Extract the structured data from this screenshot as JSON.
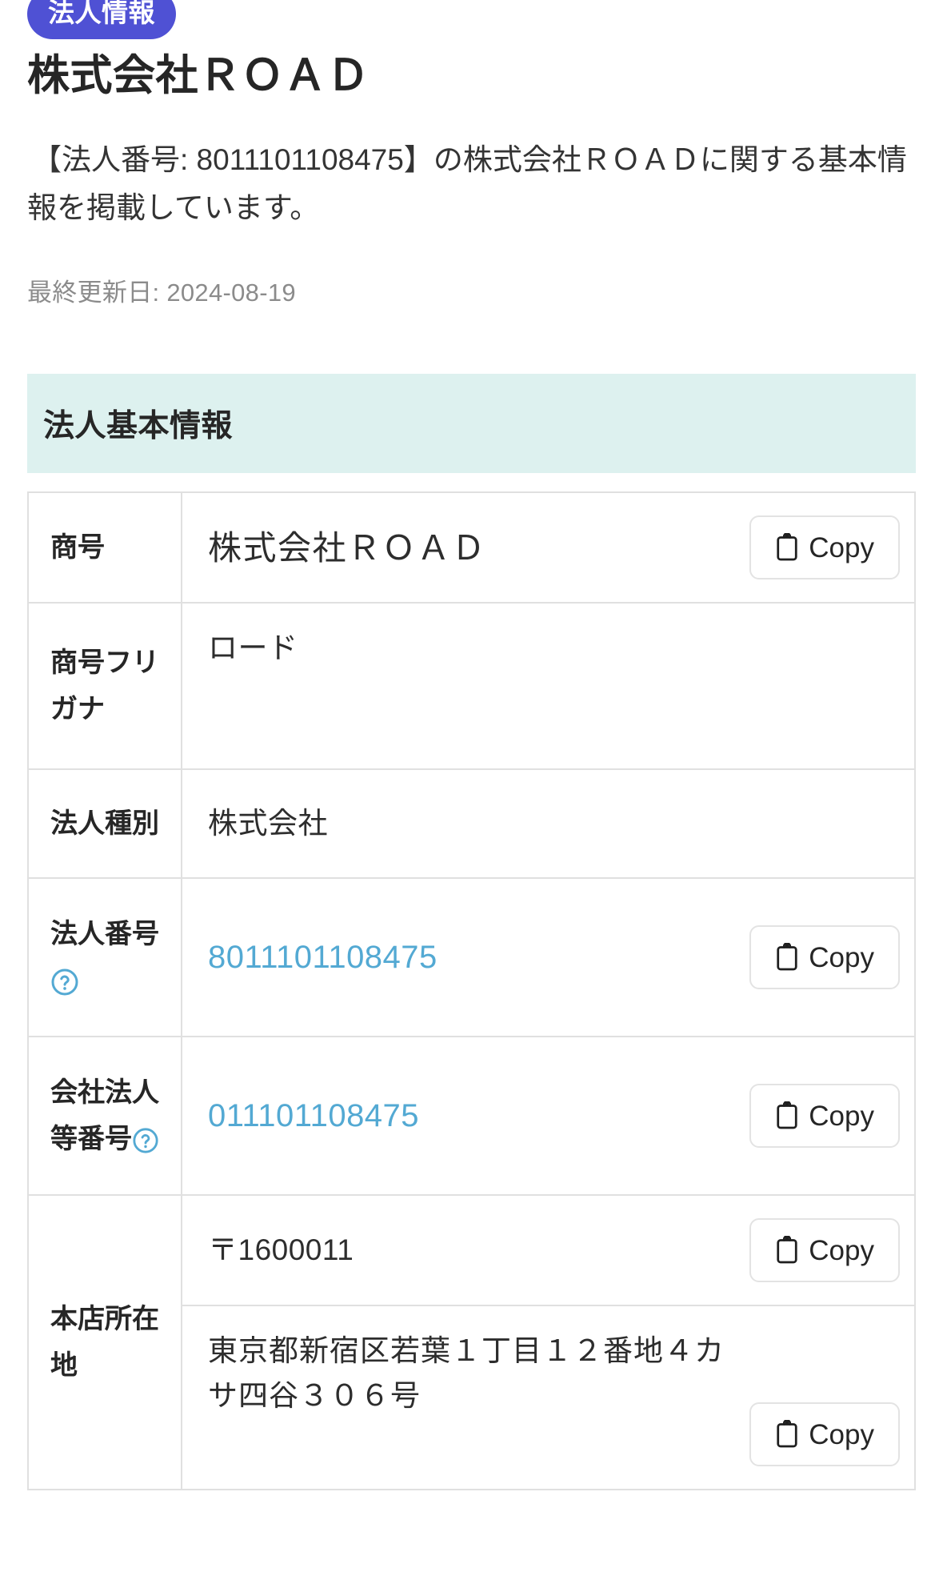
{
  "badge": {
    "label": "法人情報"
  },
  "header": {
    "title": "株式会社ＲＯＡＤ",
    "description": "【法人番号: 8011101108475】の株式会社ＲＯＡＤに関する基本情報を掲載しています。",
    "updated_label": "最終更新日: 2024-08-19"
  },
  "section": {
    "title": "法人基本情報"
  },
  "icons": {
    "copy": "clipboard-icon",
    "help": "question-circle-icon"
  },
  "colors": {
    "badge_bg": "#4f51d4",
    "section_bg": "#ddf1ef",
    "link": "#53a9d3",
    "border": "#e0e0e0",
    "muted_text": "#8b8b8b"
  },
  "buttons": {
    "copy_label": "Copy"
  },
  "table": {
    "rows": [
      {
        "label": "商号",
        "label_lines": [
          "商号"
        ],
        "has_help": false,
        "value": "株式会社ＲＯＡＤ",
        "is_link": false,
        "has_copy": true
      },
      {
        "label": "商号フリガナ",
        "label_lines": [
          "商号フリ",
          "ガナ"
        ],
        "has_help": false,
        "value": "ロード",
        "is_link": false,
        "has_copy": false
      },
      {
        "label": "法人種別",
        "label_lines": [
          "法人種別"
        ],
        "has_help": false,
        "value": "株式会社",
        "is_link": false,
        "has_copy": false
      },
      {
        "label": "法人番号",
        "label_lines": [
          "法人番号"
        ],
        "has_help": true,
        "value": "8011101108475",
        "is_link": true,
        "has_copy": true
      },
      {
        "label": "会社法人等番号",
        "label_lines": [
          "会社法人",
          "等番号"
        ],
        "has_help": true,
        "value": "011101108475",
        "is_link": true,
        "has_copy": true
      },
      {
        "label": "本店所在地",
        "label_lines": [
          "本店所在",
          "地"
        ],
        "has_help": false,
        "value_lines": [
          "〒1600011",
          "東京都新宿区若葉１丁目１２番地４カサ四谷３０６号"
        ],
        "is_link": false,
        "has_copy": true
      }
    ]
  }
}
